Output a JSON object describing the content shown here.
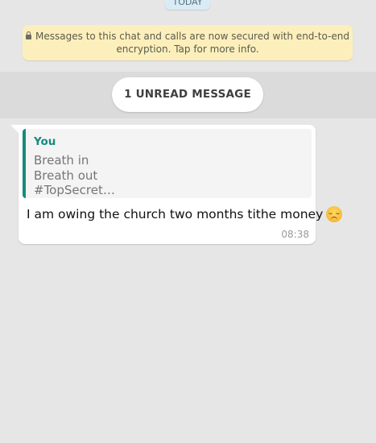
{
  "chat": {
    "date_chip": "TODAY",
    "encryption_notice": {
      "line1": "Messages to this chat and calls are now secured with end-to-end",
      "line2": "encryption. Tap for more info."
    },
    "unread_label": "1 UNREAD MESSAGE",
    "message": {
      "quote": {
        "author": "You",
        "lines": [
          "Breath in",
          "Breath out",
          "#TopSecret…"
        ]
      },
      "text": "I am owing the church two months tithe money",
      "emoji": "disappointed-face-icon",
      "time": "08:38"
    }
  },
  "colors": {
    "background": "#e6e6e6",
    "notice_bg": "#fcefbb",
    "quote_accent": "#128c7e",
    "bubble_bg": "#ffffff"
  }
}
